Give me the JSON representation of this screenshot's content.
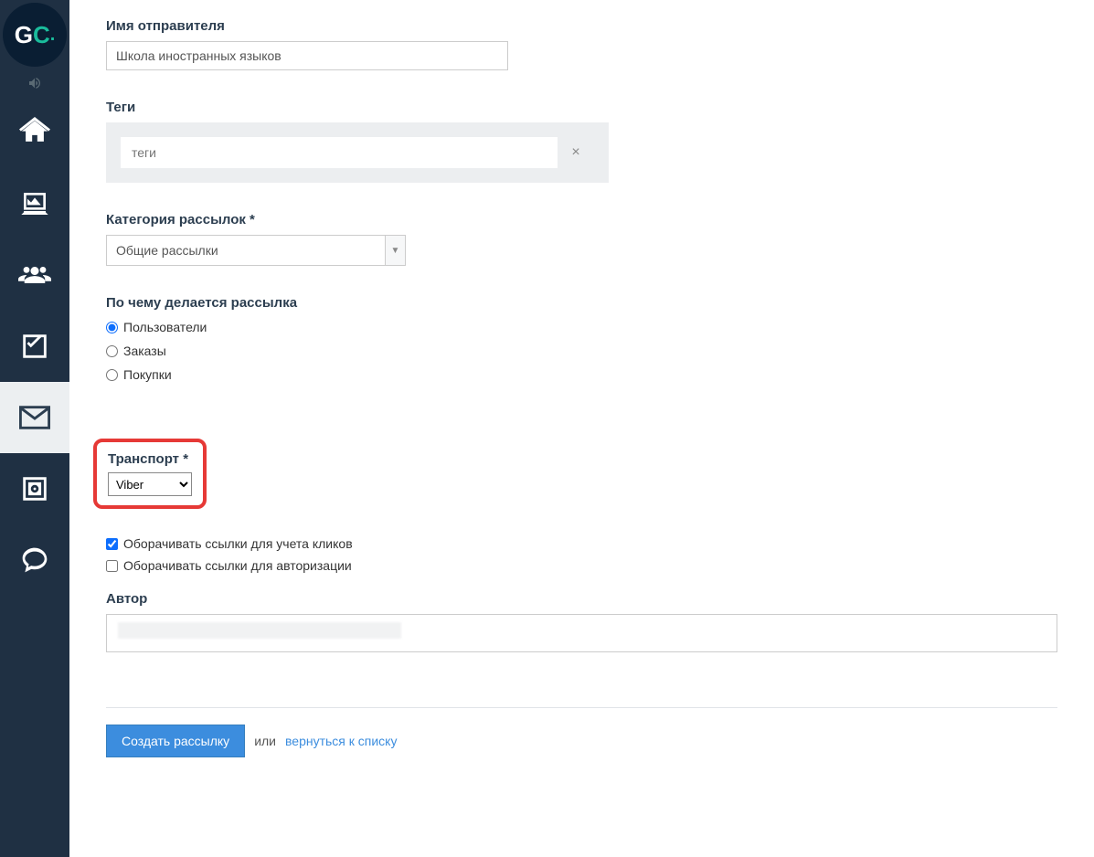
{
  "sender": {
    "label": "Имя отправителя",
    "value": "Школа иностранных языков"
  },
  "tags": {
    "label": "Теги",
    "placeholder": "теги",
    "clear_icon": "×"
  },
  "category": {
    "label": "Категория рассылок *",
    "selected": "Общие рассылки"
  },
  "send_by": {
    "label": "По чему делается рассылка",
    "options": [
      "Пользователи",
      "Заказы",
      "Покупки"
    ],
    "selected_index": 0
  },
  "transport": {
    "label": "Транспорт *",
    "selected": "Viber"
  },
  "wrap_links_clicks": {
    "label": "Оборачивать ссылки для учета кликов",
    "checked": true
  },
  "wrap_links_auth": {
    "label": "Оборачивать ссылки для авторизации",
    "checked": false
  },
  "author": {
    "label": "Автор"
  },
  "footer": {
    "submit": "Создать рассылку",
    "or": "или",
    "back": "вернуться к списку"
  }
}
